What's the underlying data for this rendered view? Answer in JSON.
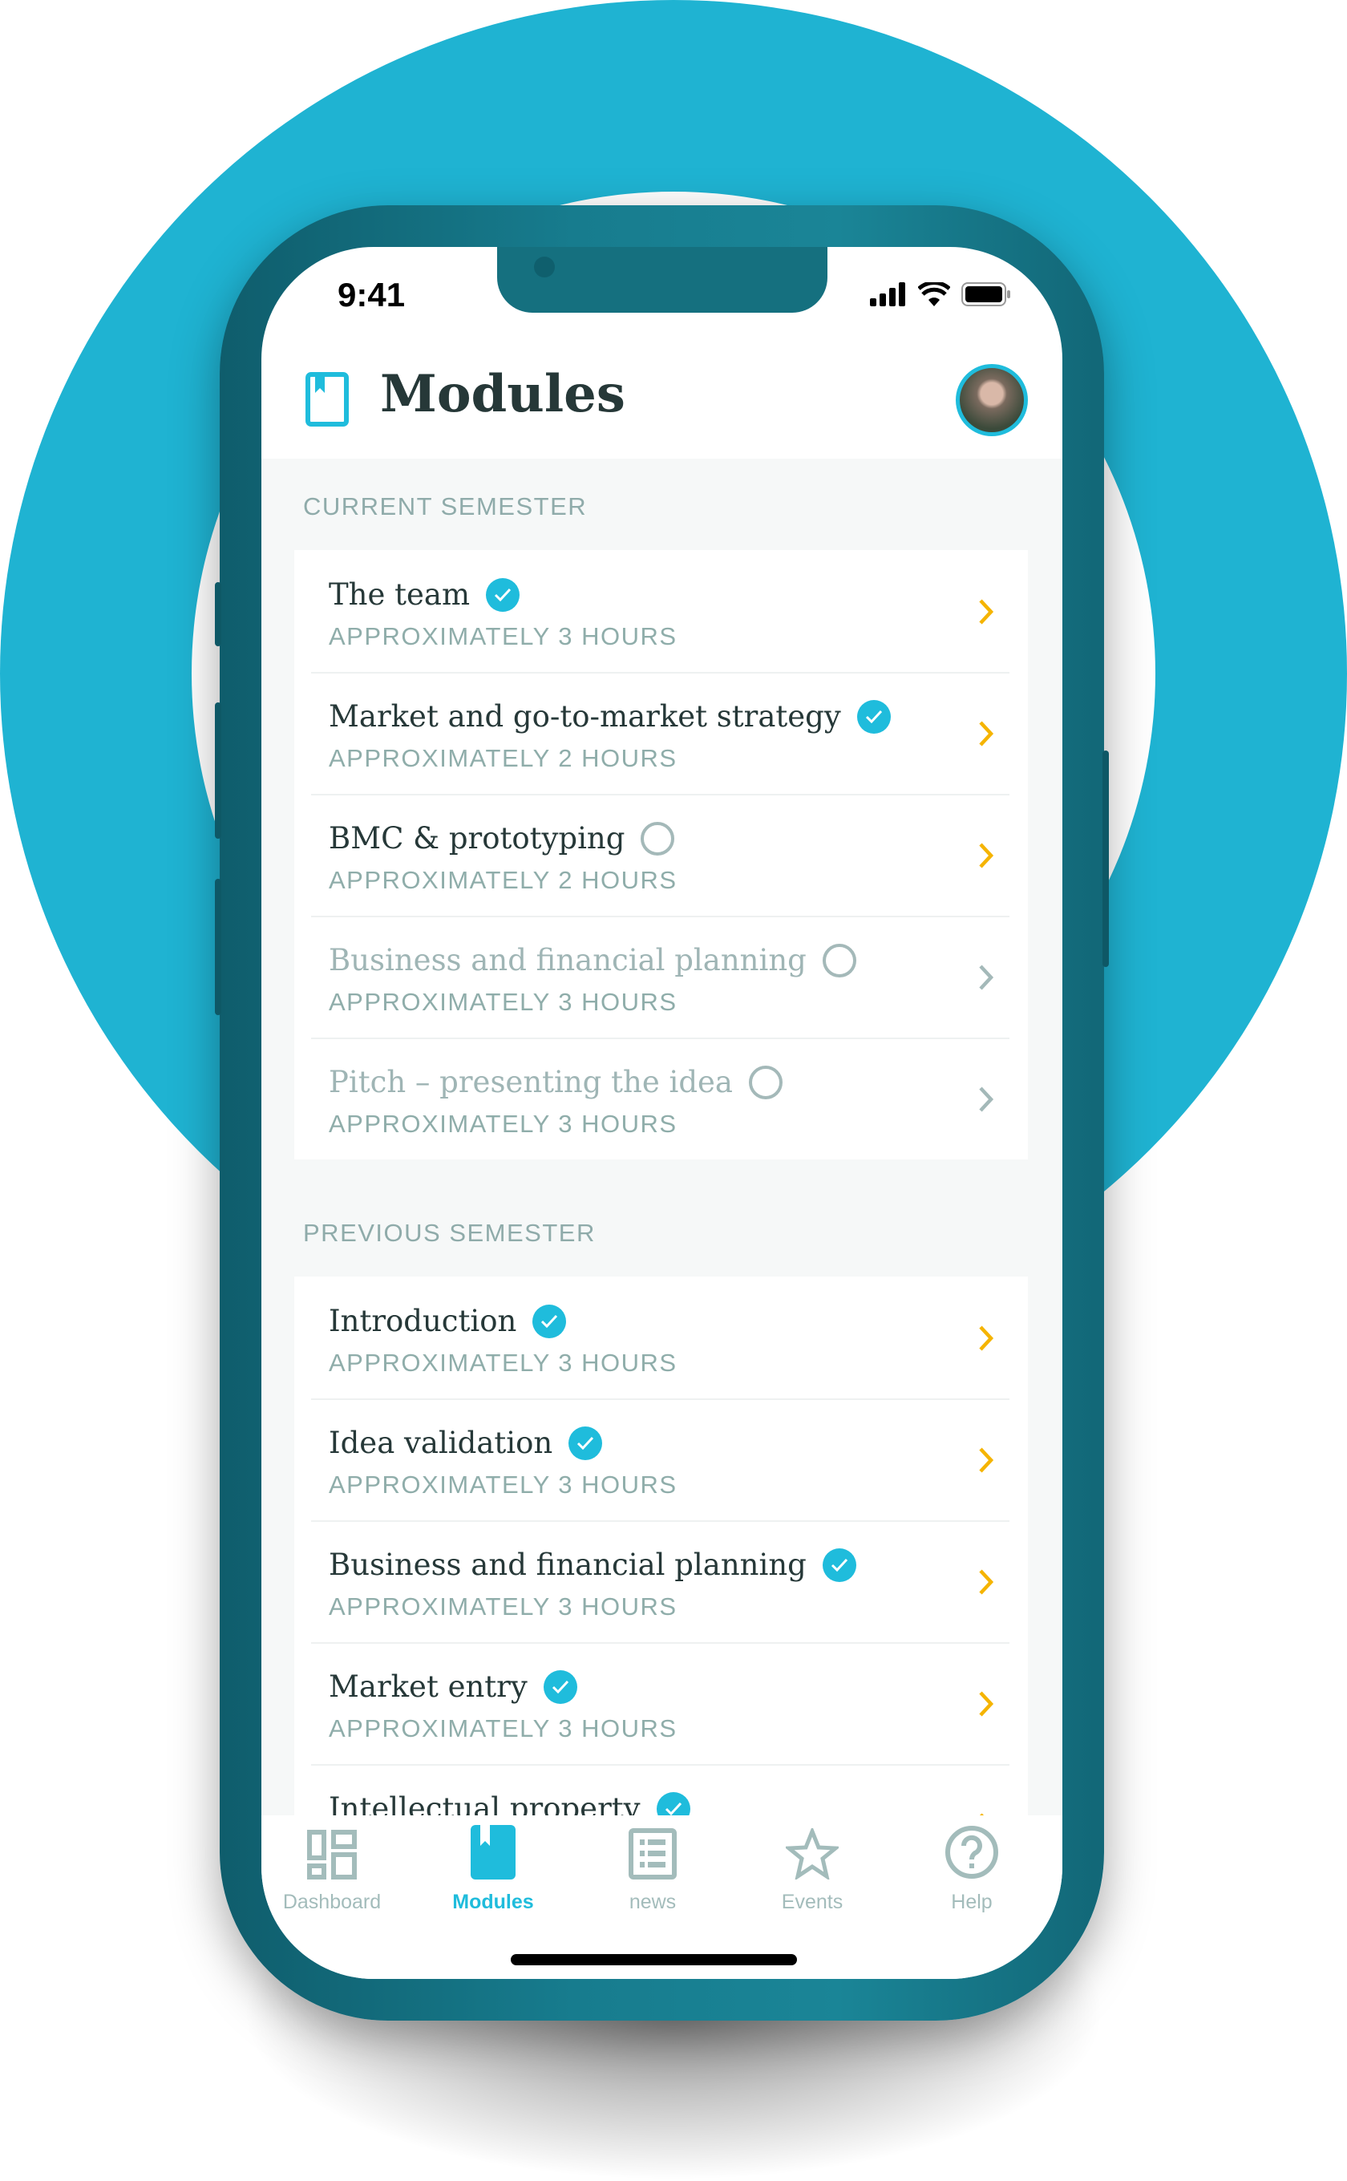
{
  "status_bar": {
    "time": "9:41"
  },
  "header": {
    "title": "Modules"
  },
  "colors": {
    "accent": "#1fbcdc",
    "chevron": "#f5b400",
    "background_ring": "#1fb3d2",
    "phone": "#177c8e"
  },
  "sections": [
    {
      "label": "CURRENT SEMESTER",
      "items": [
        {
          "title": "The team",
          "subtitle": "APPROXIMATELY 3 HOURS",
          "completed": true,
          "enabled": true
        },
        {
          "title": "Market and go-to-market strategy",
          "subtitle": "APPROXIMATELY 2 HOURS",
          "completed": true,
          "enabled": true
        },
        {
          "title": "BMC & prototyping",
          "subtitle": "APPROXIMATELY 2 HOURS",
          "completed": false,
          "enabled": true
        },
        {
          "title": "Business and financial planning",
          "subtitle": "APPROXIMATELY 3 HOURS",
          "completed": false,
          "enabled": false
        },
        {
          "title": "Pitch – presenting the idea",
          "subtitle": "APPROXIMATELY 3 HOURS",
          "completed": false,
          "enabled": false
        }
      ]
    },
    {
      "label": "PREVIOUS SEMESTER",
      "items": [
        {
          "title": "Introduction",
          "subtitle": "APPROXIMATELY 3 HOURS",
          "completed": true,
          "enabled": true
        },
        {
          "title": "Idea validation",
          "subtitle": "APPROXIMATELY 3 HOURS",
          "completed": true,
          "enabled": true
        },
        {
          "title": "Business and financial planning",
          "subtitle": "APPROXIMATELY 3 HOURS",
          "completed": true,
          "enabled": true
        },
        {
          "title": "Market entry",
          "subtitle": "APPROXIMATELY 3 HOURS",
          "completed": true,
          "enabled": true
        },
        {
          "title": "Intellectual property",
          "subtitle": "",
          "completed": true,
          "enabled": true
        }
      ]
    }
  ],
  "tabs": [
    {
      "label": "Dashboard",
      "icon": "dashboard-icon",
      "active": false
    },
    {
      "label": "Modules",
      "icon": "book-icon",
      "active": true
    },
    {
      "label": "news",
      "icon": "news-icon",
      "active": false
    },
    {
      "label": "Events",
      "icon": "star-icon",
      "active": false
    },
    {
      "label": "Help",
      "icon": "help-icon",
      "active": false
    }
  ]
}
